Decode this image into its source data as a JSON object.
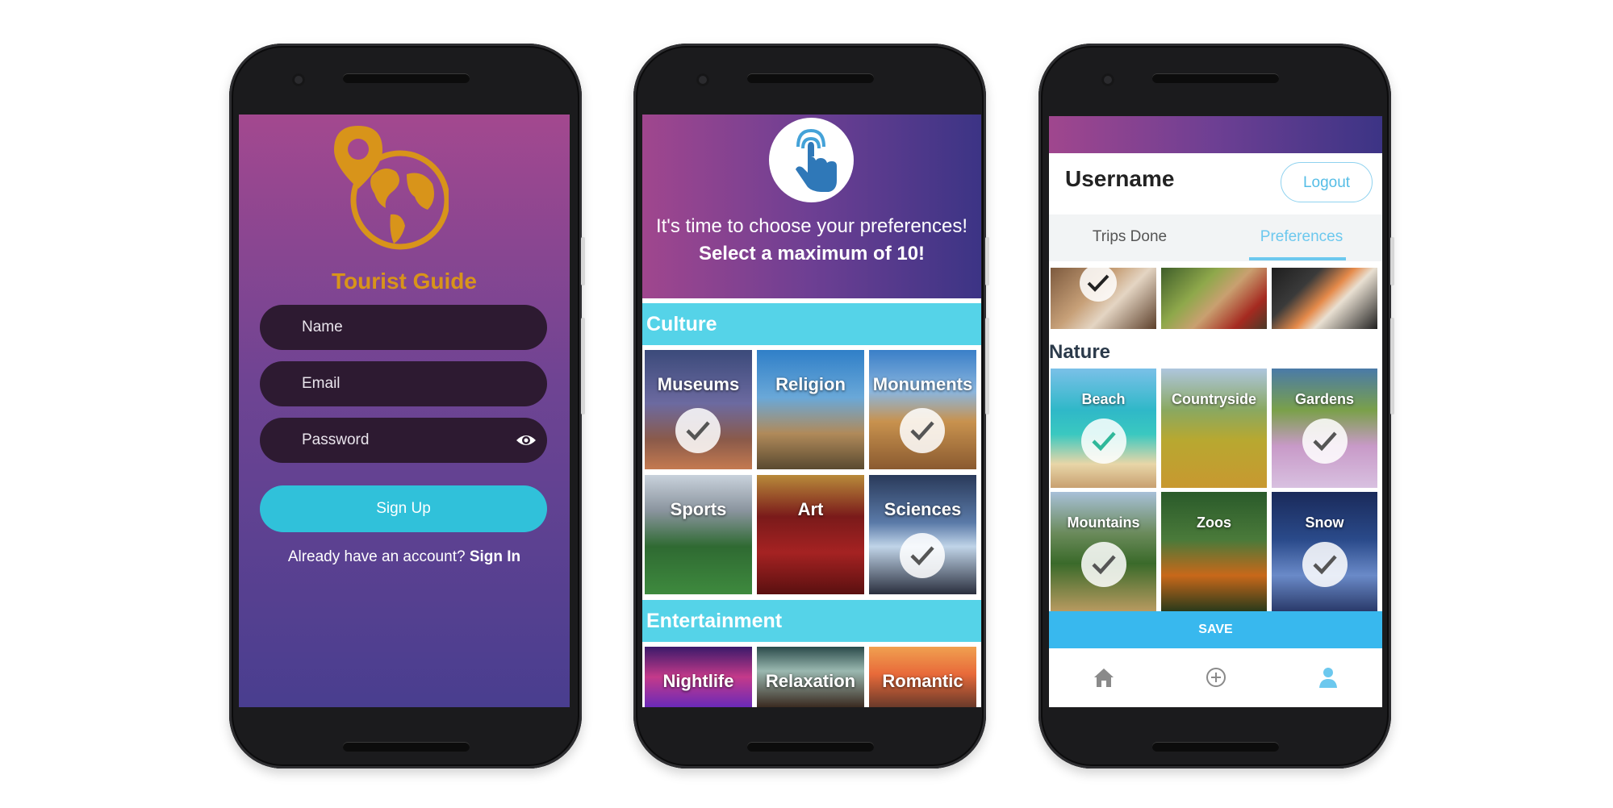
{
  "signup_screen": {
    "brand": "Tourist Guide",
    "name_placeholder": "Name",
    "email_placeholder": "Email",
    "password_placeholder": "Password",
    "signup_label": "Sign Up",
    "already_text": "Already have an account?",
    "signin_link": "Sign In",
    "colors": {
      "brand": "#d8941a",
      "button": "#30c1da",
      "field": "#2d1a31"
    }
  },
  "preferences_screen": {
    "line1": "It's time to choose your preferences!",
    "line2": "Select a maximum of 10!",
    "culture_title": "Culture",
    "culture_tiles": [
      {
        "label": "Museums",
        "checked": true
      },
      {
        "label": "Religion",
        "checked": false
      },
      {
        "label": "Monuments",
        "checked": true
      },
      {
        "label": "Sports",
        "checked": false
      },
      {
        "label": "Art",
        "checked": false
      },
      {
        "label": "Sciences",
        "checked": true
      }
    ],
    "entertainment_title": "Entertainment",
    "entertainment_tiles": [
      {
        "label": "Nightlife"
      },
      {
        "label": "Relaxation"
      },
      {
        "label": "Romantic"
      }
    ],
    "colors": {
      "category_bar": "#55d3e8"
    }
  },
  "profile_screen": {
    "username": "Username",
    "logout_label": "Logout",
    "tabs": [
      "Trips Done",
      "Preferences"
    ],
    "active_tab": "Preferences",
    "nature_title": "Nature",
    "nature_tiles": [
      {
        "label": "Beach",
        "checked": true
      },
      {
        "label": "Countryside",
        "checked": false
      },
      {
        "label": "Gardens",
        "checked": true
      },
      {
        "label": "Mountains",
        "checked": true
      },
      {
        "label": "Zoos",
        "checked": false
      },
      {
        "label": "Snow",
        "checked": true
      }
    ],
    "save_label": "SAVE",
    "nav_icons": [
      "home-icon",
      "add-circle-icon",
      "person-icon"
    ],
    "colors": {
      "accent": "#6cc8ee",
      "save": "#38b8ee"
    }
  }
}
